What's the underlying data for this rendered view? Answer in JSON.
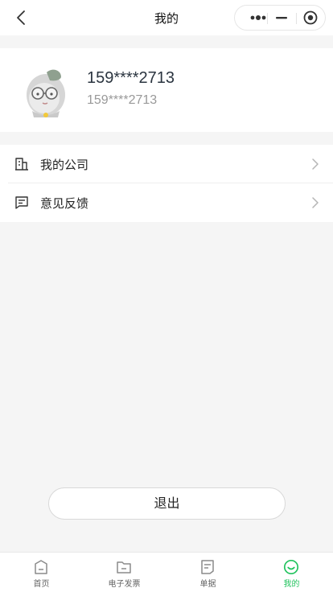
{
  "navbar": {
    "title": "我的",
    "back_icon": "chevron-left-icon",
    "capsule_icons": [
      "more-dots-icon",
      "minimize-icon",
      "target-close-icon"
    ]
  },
  "profile": {
    "name": "159****2713",
    "account": "159****2713",
    "avatar_icon": "cartoon-avatar-icon"
  },
  "menu": {
    "items": [
      {
        "label": "我的公司",
        "icon": "building-icon"
      },
      {
        "label": "意见反馈",
        "icon": "feedback-icon"
      }
    ]
  },
  "logout_label": "退出",
  "tabbar": {
    "active_color": "#22c35e",
    "items": [
      {
        "label": "首页",
        "icon": "home-icon",
        "active": false
      },
      {
        "label": "电子发票",
        "icon": "folder-icon",
        "active": false
      },
      {
        "label": "单据",
        "icon": "document-icon",
        "active": false
      },
      {
        "label": "我的",
        "icon": "smile-icon",
        "active": true
      }
    ]
  }
}
